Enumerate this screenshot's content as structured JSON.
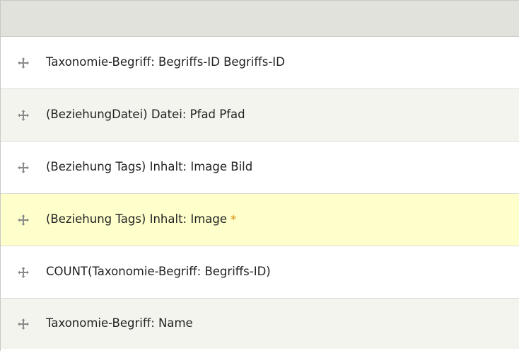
{
  "table": {
    "rows": [
      {
        "label": "Taxonomie-Begriff: Begriffs-ID Begriffs-ID",
        "icon": "drag-handle-icon"
      },
      {
        "label": "(BeziehungDatei) Datei: Pfad Pfad",
        "icon": "drag-handle-icon"
      },
      {
        "label": "(Beziehung Tags) Inhalt: Image Bild",
        "icon": "drag-handle-icon"
      },
      {
        "label": "(Beziehung Tags) Inhalt: Image",
        "changed_marker": "*",
        "icon": "drag-handle-icon"
      },
      {
        "label": "COUNT(Taxonomie-Begriff: Begriffs-ID)",
        "icon": "drag-handle-icon"
      },
      {
        "label": "Taxonomie-Begriff: Name",
        "icon": "drag-handle-icon"
      }
    ]
  },
  "colors": {
    "header_bg": "#e1e2dc",
    "row_odd": "#ffffff",
    "row_even": "#f3f4ee",
    "row_highlight": "#ffffcc",
    "changed_marker": "#d98c00"
  }
}
